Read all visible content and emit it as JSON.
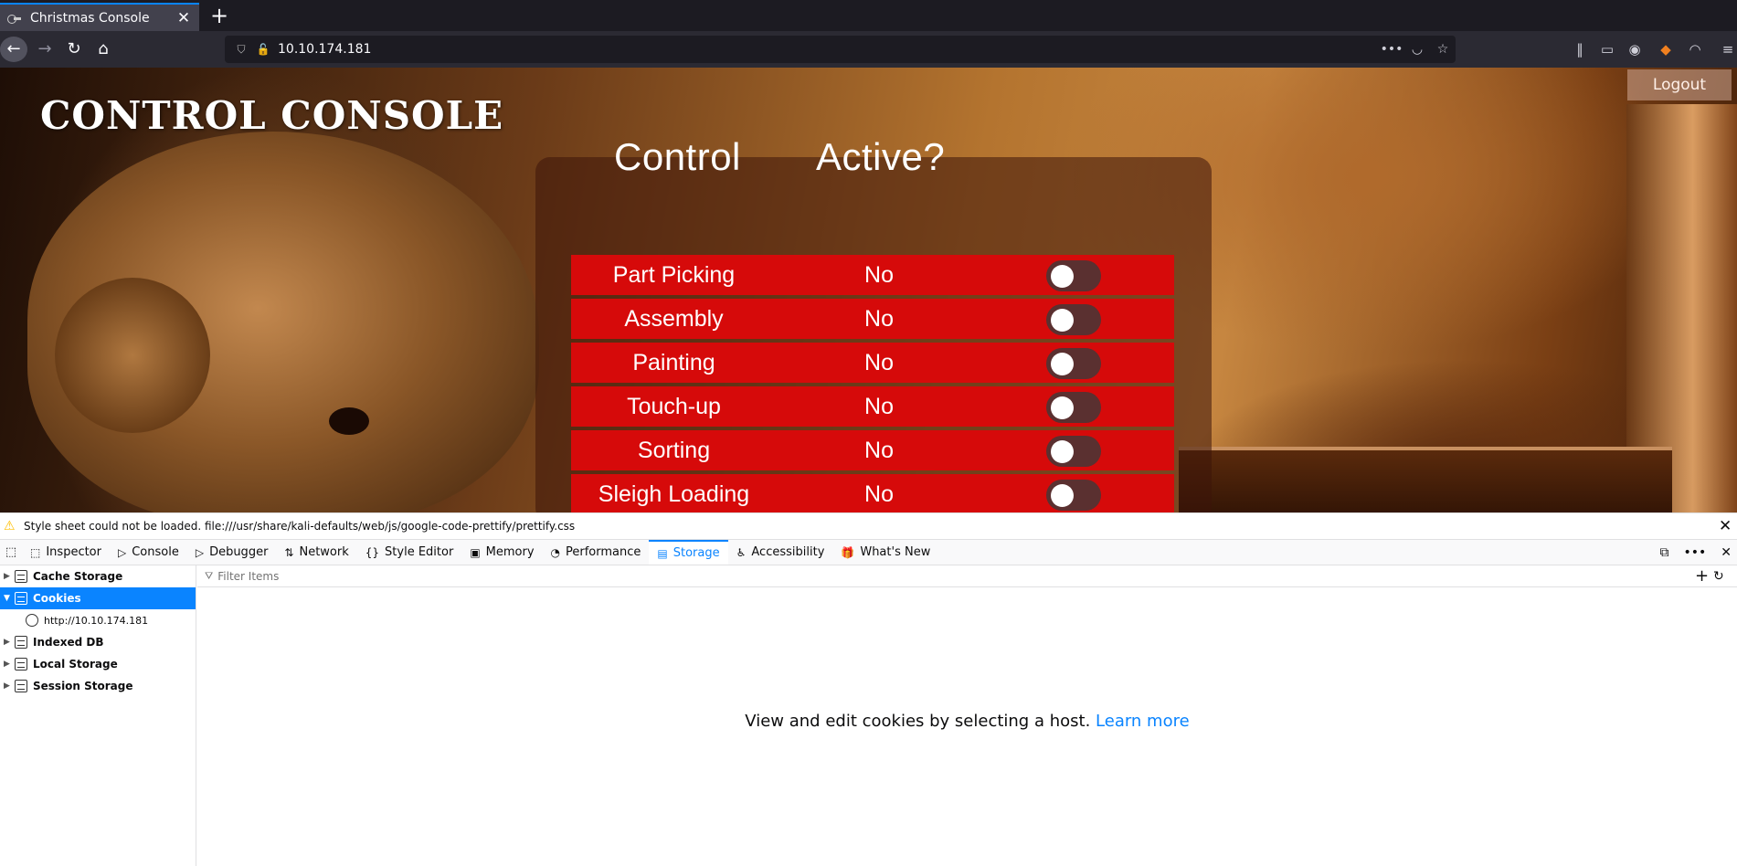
{
  "browser": {
    "tab_title": "Christmas Console",
    "new_tab": "+",
    "url": "10.10.174.181"
  },
  "page": {
    "title": "CONTROL CONSOLE",
    "logout_label": "Logout",
    "headers": {
      "control": "Control",
      "active": "Active?"
    },
    "controls": [
      {
        "name": "Part Picking",
        "active": "No"
      },
      {
        "name": "Assembly",
        "active": "No"
      },
      {
        "name": "Painting",
        "active": "No"
      },
      {
        "name": "Touch-up",
        "active": "No"
      },
      {
        "name": "Sorting",
        "active": "No"
      },
      {
        "name": "Sleigh Loading",
        "active": "No"
      }
    ]
  },
  "devtools": {
    "notice": "Style sheet could not be loaded. file:///usr/share/kali-defaults/web/js/google-code-prettify/prettify.css",
    "tabs": [
      "Inspector",
      "Console",
      "Debugger",
      "Network",
      "Style Editor",
      "Memory",
      "Performance",
      "Storage",
      "Accessibility",
      "What's New"
    ],
    "active_tab": "Storage",
    "tree": {
      "cache_storage": "Cache Storage",
      "cookies": "Cookies",
      "cookie_host": "http://10.10.174.181",
      "indexed_db": "Indexed DB",
      "local_storage": "Local Storage",
      "session_storage": "Session Storage"
    },
    "filter_placeholder": "Filter Items",
    "empty_message": "View and edit cookies by selecting a host.",
    "learn_more": "Learn more"
  }
}
